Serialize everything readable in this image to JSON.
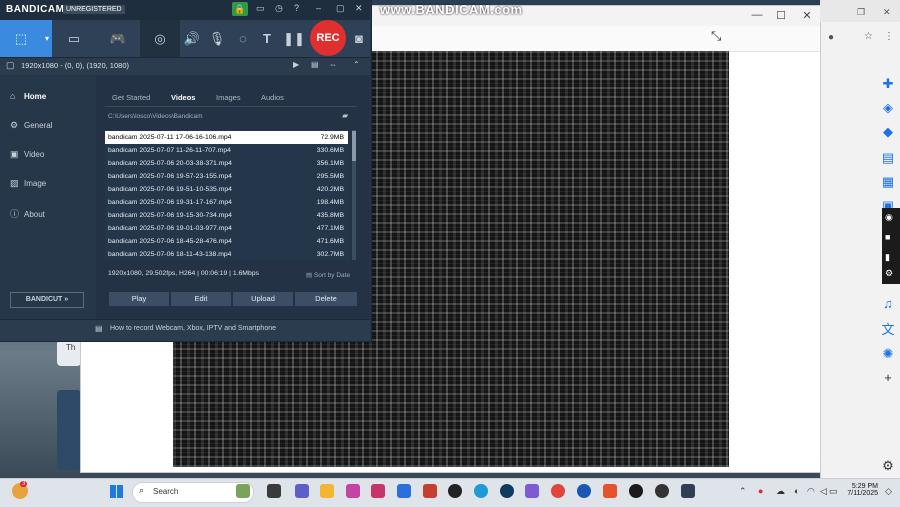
{
  "watermark": "www.BANDICAM.com",
  "bandicam": {
    "logo": "BANDICAM",
    "unregistered": "UNREGISTERED",
    "rec_label": "REC",
    "resolution_text": "1920x1080 - (0, 0), (1920, 1080)",
    "sidebar": [
      {
        "label": "Home",
        "icon": "home-icon"
      },
      {
        "label": "General",
        "icon": "gear-icon"
      },
      {
        "label": "Video",
        "icon": "video-icon"
      },
      {
        "label": "Image",
        "icon": "image-icon"
      },
      {
        "label": "About",
        "icon": "info-icon"
      }
    ],
    "tabs": [
      "Get Started",
      "Videos",
      "Images",
      "Audios"
    ],
    "active_tab": "Videos",
    "path": "C:\\Users\\losco\\Videos\\Bandicam",
    "files": [
      {
        "name": "bandicam 2025-07-11 17-06-16-106.mp4",
        "size": "72.9MB"
      },
      {
        "name": "bandicam 2025-07-07 11-26-11-707.mp4",
        "size": "330.6MB"
      },
      {
        "name": "bandicam 2025-07-06 20-03-38-371.mp4",
        "size": "356.1MB"
      },
      {
        "name": "bandicam 2025-07-06 19-57-23-155.mp4",
        "size": "295.5MB"
      },
      {
        "name": "bandicam 2025-07-06 19-51-10-535.mp4",
        "size": "420.2MB"
      },
      {
        "name": "bandicam 2025-07-06 19-31-17-167.mp4",
        "size": "198.4MB"
      },
      {
        "name": "bandicam 2025-07-06 19-15-30-734.mp4",
        "size": "435.8MB"
      },
      {
        "name": "bandicam 2025-07-06 19-01-03-977.mp4",
        "size": "477.1MB"
      },
      {
        "name": "bandicam 2025-07-06 18-45-28-476.mp4",
        "size": "471.6MB"
      },
      {
        "name": "bandicam 2025-07-06 18-11-43-138.mp4",
        "size": "302.7MB"
      }
    ],
    "file_info": "1920x1080, 29.502fps, H264 | 00:06:19 | 1.6Mbps",
    "sort_label": "Sort by Date",
    "actions": {
      "play": "Play",
      "edit": "Edit",
      "upload": "Upload",
      "delete": "Delete"
    },
    "bandicut": "BANDICUT",
    "tip": "How to record Webcam, Xbox, IPTV and Smartphone"
  },
  "desktop": {
    "thumb_text": "Th"
  },
  "taskbar": {
    "search_placeholder": "Search",
    "time": "5:29 PM",
    "date": "7/11/2025",
    "notification_count": "3"
  }
}
